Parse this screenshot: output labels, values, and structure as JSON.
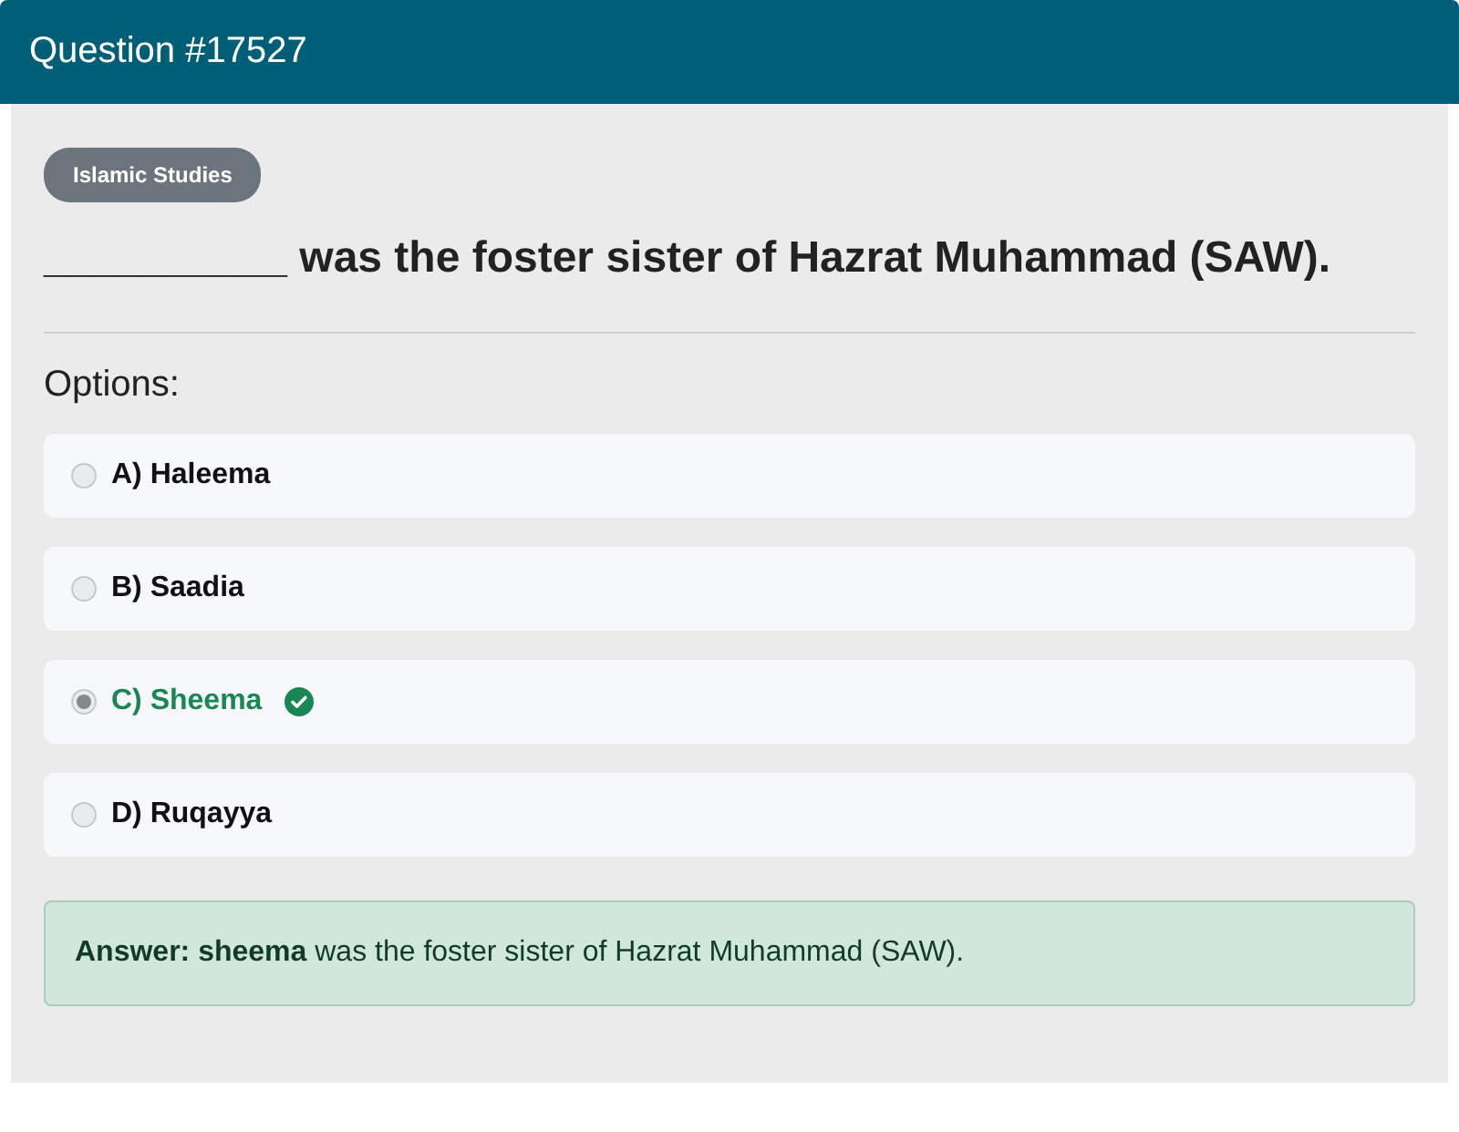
{
  "header": {
    "title": "Question #17527"
  },
  "category": "Islamic Studies",
  "question": "__________ was the foster sister of Hazrat Muhammad (SAW).",
  "options_label": "Options:",
  "options": [
    {
      "label": "A) Haleema",
      "selected": false,
      "correct": false
    },
    {
      "label": "B) Saadia",
      "selected": false,
      "correct": false
    },
    {
      "label": "C) Sheema",
      "selected": true,
      "correct": true
    },
    {
      "label": "D) Ruqayya",
      "selected": false,
      "correct": false
    }
  ],
  "answer": "**Answer: sheema** was the foster sister of Hazrat Muhammad (SAW)."
}
